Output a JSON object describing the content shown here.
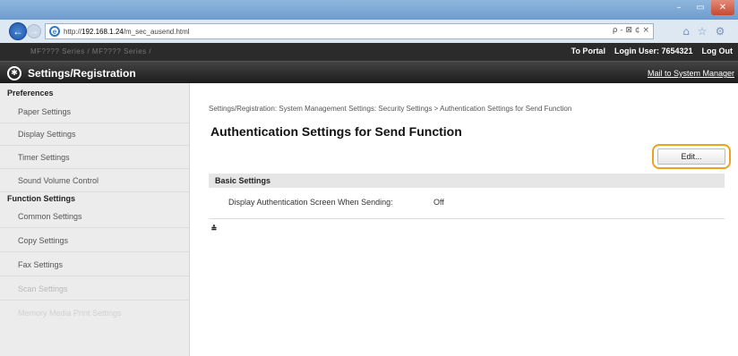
{
  "window": {
    "minimize_icon": "minimize-icon",
    "maximize_icon": "maximize-icon",
    "close_icon": "close-icon",
    "min_glyph": "–",
    "max_glyph": "▭",
    "close_glyph": "✕"
  },
  "browser": {
    "back_glyph": "←",
    "forward_glyph": "→",
    "url_prefix": "http://",
    "url_host": "192.168.1.24",
    "url_path": "/m_sec_ausend.html",
    "addr_tools": "ρ - ⊠ ¢ ×",
    "home_glyph": "⌂",
    "favorites_glyph": "☆",
    "tools_glyph": "⚙"
  },
  "header": {
    "model": "MF???? Series / MF???? Series /",
    "to_portal": "To Portal",
    "login_user": "Login User:  7654321",
    "log_out": "Log Out",
    "app_title": "Settings/Registration",
    "mail_admin": "Mail to System Manager"
  },
  "sidebar": {
    "preferences_heading": "Preferences",
    "preferences_items": [
      {
        "label": "Paper Settings"
      },
      {
        "label": "Display Settings"
      },
      {
        "label": "Timer Settings"
      },
      {
        "label": "Sound Volume Control"
      }
    ],
    "function_heading": "Function Settings",
    "function_items": [
      {
        "label": "Common Settings"
      },
      {
        "label": "Copy Settings"
      },
      {
        "label": "Fax Settings"
      },
      {
        "label": "Scan Settings"
      },
      {
        "label": "Memory Media Print Settings"
      }
    ]
  },
  "main": {
    "breadcrumb": "Settings/Registration: System Management Settings: Security Settings > Authentication Settings for Send Function",
    "page_title": "Authentication Settings for Send Function",
    "edit_button": "Edit...",
    "section_title": "Basic Settings",
    "settings": [
      {
        "label": "Display Authentication Screen When Sending:",
        "value": "Off"
      }
    ],
    "to_top_glyph": "⩮"
  },
  "colors": {
    "highlight_ring": "#f0a020",
    "header_dark": "#2b2b2b"
  }
}
